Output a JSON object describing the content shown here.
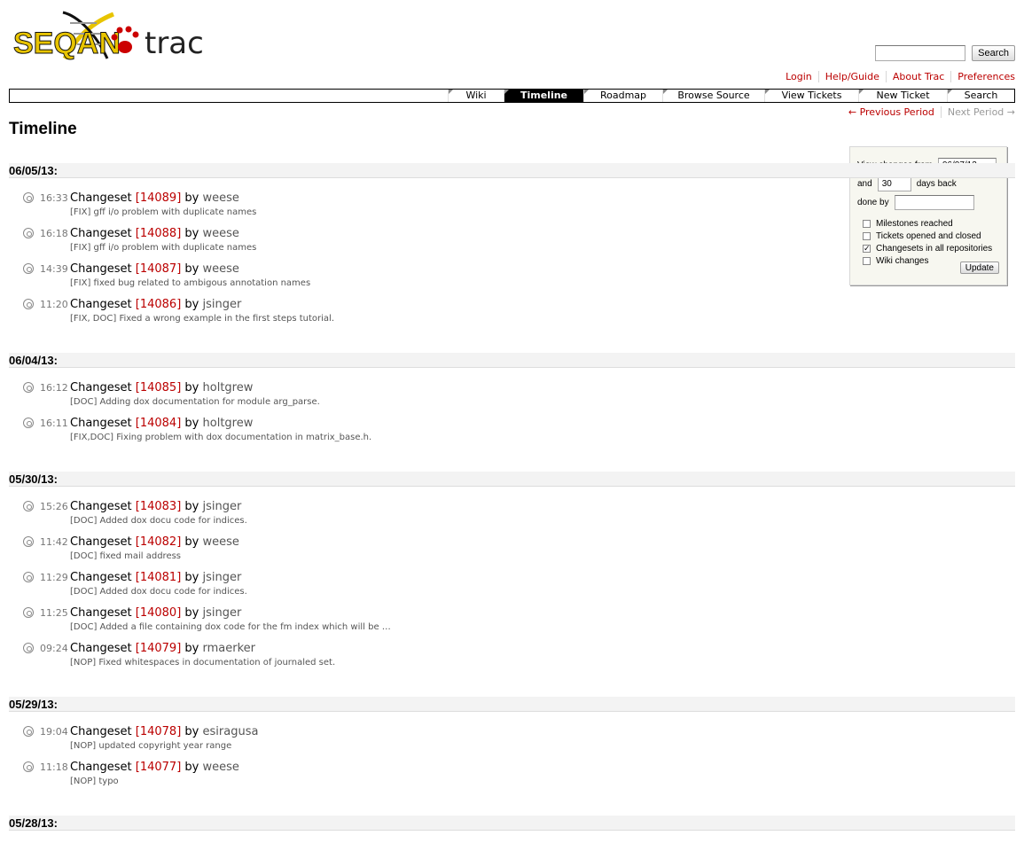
{
  "logo": {
    "text_left": "SEQAN",
    "text_right": "trac"
  },
  "search": {
    "button_label": "Search",
    "placeholder": ""
  },
  "metanav": [
    "Login",
    "Help/Guide",
    "About Trac",
    "Preferences"
  ],
  "mainnav": [
    {
      "label": "Wiki",
      "active": false
    },
    {
      "label": "Timeline",
      "active": true
    },
    {
      "label": "Roadmap",
      "active": false
    },
    {
      "label": "Browse Source",
      "active": false
    },
    {
      "label": "View Tickets",
      "active": false
    },
    {
      "label": "New Ticket",
      "active": false
    },
    {
      "label": "Search",
      "active": false
    }
  ],
  "ctxtnav": {
    "prev": "← Previous Period",
    "next": "Next Period →"
  },
  "page_title": "Timeline",
  "prefs": {
    "from_label": "View changes from",
    "from_value": "06/07/13",
    "and_label": "and",
    "days_value": "30",
    "days_label": "days back",
    "doneby_label": "done by",
    "doneby_value": "",
    "filters": [
      {
        "label": "Milestones reached",
        "checked": false
      },
      {
        "label": "Tickets opened and closed",
        "checked": false
      },
      {
        "label": "Changesets in all repositories",
        "checked": true
      },
      {
        "label": "Wiki changes",
        "checked": false
      }
    ],
    "update_label": "Update"
  },
  "days": [
    {
      "date": "06/05/13:",
      "entries": [
        {
          "time": "16:33",
          "cs": "[14089]",
          "author": "weese",
          "msg": "[FIX] gff i/o problem with duplicate names"
        },
        {
          "time": "16:18",
          "cs": "[14088]",
          "author": "weese",
          "msg": "[FIX] gff i/o problem with duplicate names"
        },
        {
          "time": "14:39",
          "cs": "[14087]",
          "author": "weese",
          "msg": "[FIX] fixed bug related to ambigous annotation names"
        },
        {
          "time": "11:20",
          "cs": "[14086]",
          "author": "jsinger",
          "msg": "[FIX, DOC] Fixed a wrong example in the first steps tutorial."
        }
      ]
    },
    {
      "date": "06/04/13:",
      "entries": [
        {
          "time": "16:12",
          "cs": "[14085]",
          "author": "holtgrew",
          "msg": "[DOC] Adding dox documentation for module arg_parse."
        },
        {
          "time": "16:11",
          "cs": "[14084]",
          "author": "holtgrew",
          "msg": "[FIX,DOC] Fixing problem with dox documentation in matrix_base.h."
        }
      ]
    },
    {
      "date": "05/30/13:",
      "entries": [
        {
          "time": "15:26",
          "cs": "[14083]",
          "author": "jsinger",
          "msg": "[DOC] Added dox docu code for indices."
        },
        {
          "time": "11:42",
          "cs": "[14082]",
          "author": "weese",
          "msg": "[DOC] fixed mail address"
        },
        {
          "time": "11:29",
          "cs": "[14081]",
          "author": "jsinger",
          "msg": "[DOC] Added dox docu code for indices."
        },
        {
          "time": "11:25",
          "cs": "[14080]",
          "author": "jsinger",
          "msg": "[DOC] Added a file containing dox code for the fm index which will be …"
        },
        {
          "time": "09:24",
          "cs": "[14079]",
          "author": "rmaerker",
          "msg": "[NOP] Fixed whitespaces in documentation of journaled set."
        }
      ]
    },
    {
      "date": "05/29/13:",
      "entries": [
        {
          "time": "19:04",
          "cs": "[14078]",
          "author": "esiragusa",
          "msg": "[NOP] updated copyright year range"
        },
        {
          "time": "11:18",
          "cs": "[14077]",
          "author": "weese",
          "msg": "[NOP] typo"
        }
      ]
    },
    {
      "date": "05/28/13:",
      "entries": []
    }
  ],
  "labels": {
    "changeset": "Changeset",
    "by": "by"
  }
}
